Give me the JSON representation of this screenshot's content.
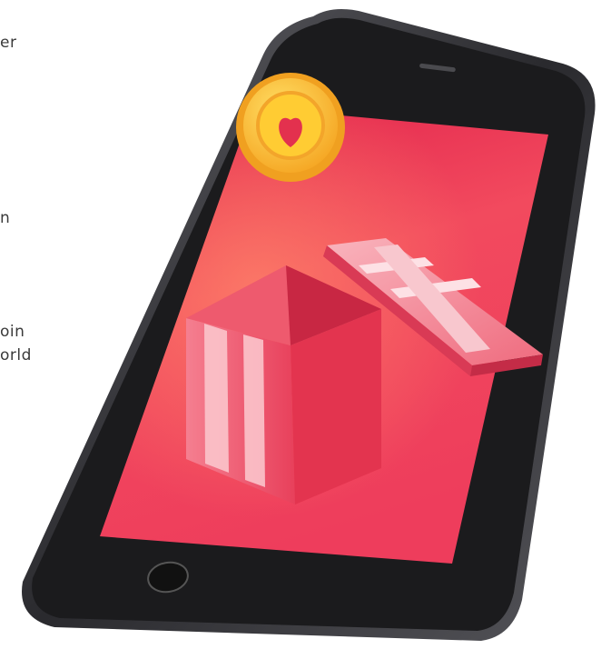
{
  "text_fragments": [
    "er",
    "n",
    "oin",
    "orld"
  ],
  "colors": {
    "screen_top": "#e8234f",
    "screen_bottom": "#f04a62",
    "phone_body": "#1c1c1e",
    "phone_frame": "#4a4a4e",
    "coin_outer": "#f6a623",
    "coin_inner": "#ffd24d",
    "heart": "#e6304f",
    "gift_light": "#f7a8b2",
    "gift_dark": "#e5334f"
  },
  "icons": [
    "heart-coin-icon",
    "gift-box-icon",
    "home-button-icon"
  ]
}
